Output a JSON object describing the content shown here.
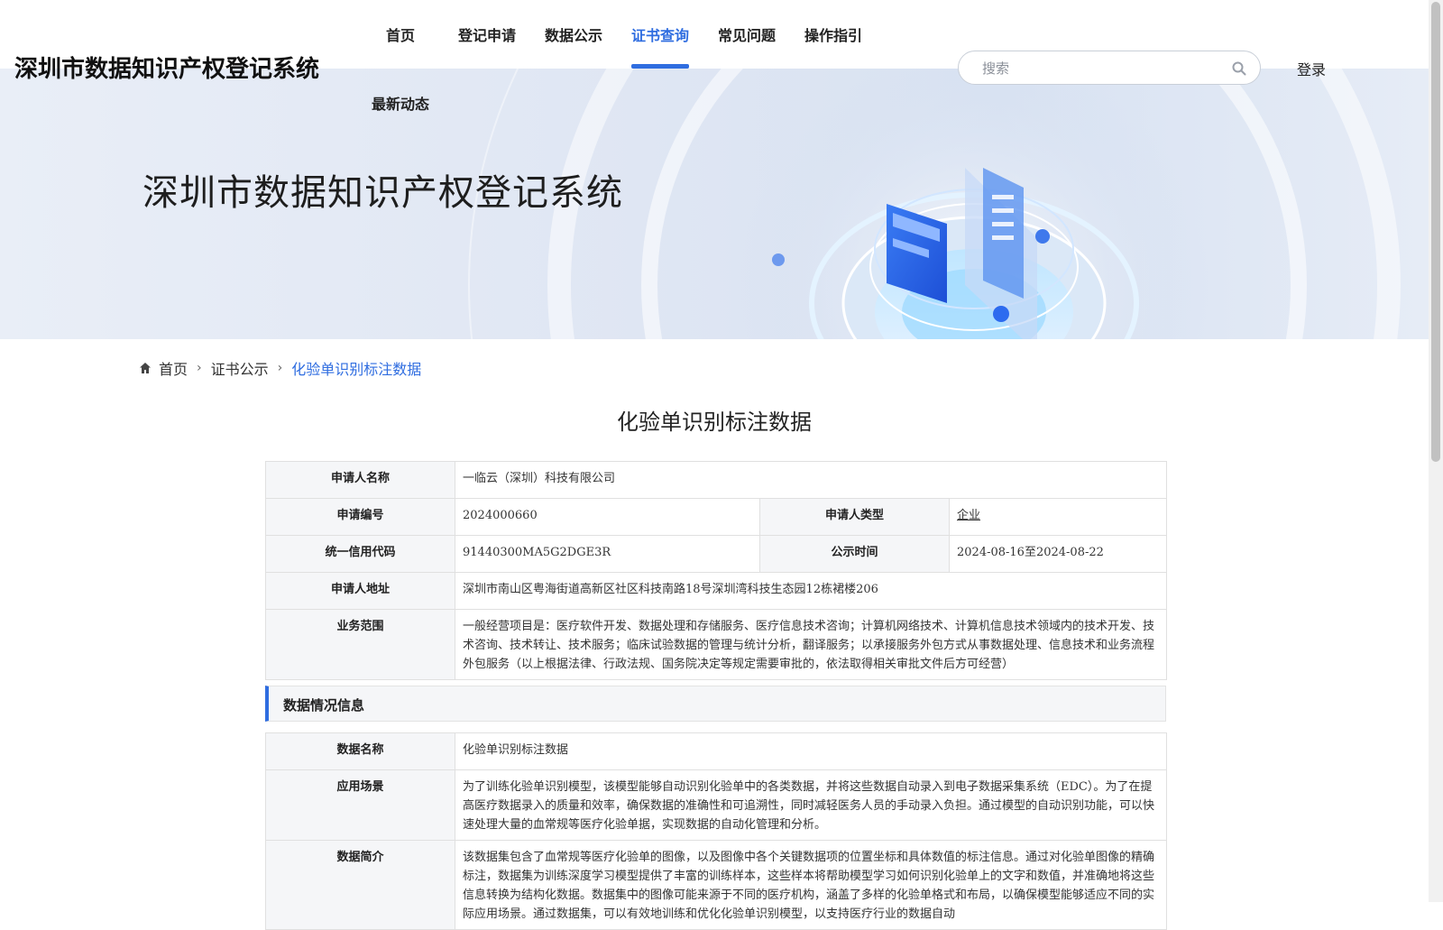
{
  "header": {
    "site_title": "深圳市数据知识产权登记系统",
    "nav": [
      "首页",
      "登记申请",
      "数据公示",
      "证书查询",
      "常见问题",
      "操作指引"
    ],
    "nav_active": "证书查询",
    "nav_second": "最新动态",
    "search_placeholder": "搜索",
    "login": "登录"
  },
  "banner": {
    "title": "深圳市数据知识产权登记系统"
  },
  "breadcrumb": {
    "home": "首页",
    "level2": "证书公示",
    "current": "化验单识别标注数据"
  },
  "page_title": "化验单识别标注数据",
  "applicant": {
    "name_label": "申请人名称",
    "name_value": "一临云（深圳）科技有限公司",
    "code_label": "申请编号",
    "code_value": "2024000660",
    "type_label": "申请人类型",
    "type_value": "企业",
    "credit_label": "统一信用代码",
    "credit_value": "91440300MA5G2DGE3R",
    "period_label": "公示时间",
    "period_value": "2024-08-16至2024-08-22",
    "address_label": "申请人地址",
    "address_value": "深圳市南山区粤海街道高新区社区科技南路18号深圳湾科技生态园12栋裙楼206",
    "scope_label": "业务范围",
    "scope_value": "一般经营项目是：医疗软件开发、数据处理和存储服务、医疗信息技术咨询；计算机网络技术、计算机信息技术领域内的技术开发、技术咨询、技术转让、技术服务；临床试验数据的管理与统计分析，翻译服务；以承接服务外包方式从事数据处理、信息技术和业务流程外包服务（以上根据法律、行政法规、国务院决定等规定需要审批的，依法取得相关审批文件后方可经营）"
  },
  "data_section": {
    "title": "数据情况信息",
    "name_label": "数据名称",
    "name_value": "化验单识别标注数据",
    "scene_label": "应用场景",
    "scene_value": "为了训练化验单识别模型，该模型能够自动识别化验单中的各类数据，并将这些数据自动录入到电子数据采集系统（EDC）。为了在提高医疗数据录入的质量和效率，确保数据的准确性和可追溯性，同时减轻医务人员的手动录入负担。通过模型的自动识别功能，可以快速处理大量的血常规等医疗化验单据，实现数据的自动化管理和分析。",
    "intro_label": "数据简介",
    "intro_value": "该数据集包含了血常规等医疗化验单的图像，以及图像中各个关键数据项的位置坐标和具体数值的标注信息。通过对化验单图像的精确标注，数据集为训练深度学习模型提供了丰富的训练样本，这些样本将帮助模型学习如何识别化验单上的文字和数值，并准确地将这些信息转换为结构化数据。数据集中的图像可能来源于不同的医疗机构，涵盖了多样的化验单格式和布局，以确保模型能够适应不同的实际应用场景。通过数据集，可以有效地训练和优化化验单识别模型，以支持医疗行业的数据自动"
  },
  "colors": {
    "accent": "#2f6de0"
  },
  "icons": {
    "search": "search-icon",
    "home": "home-icon"
  }
}
